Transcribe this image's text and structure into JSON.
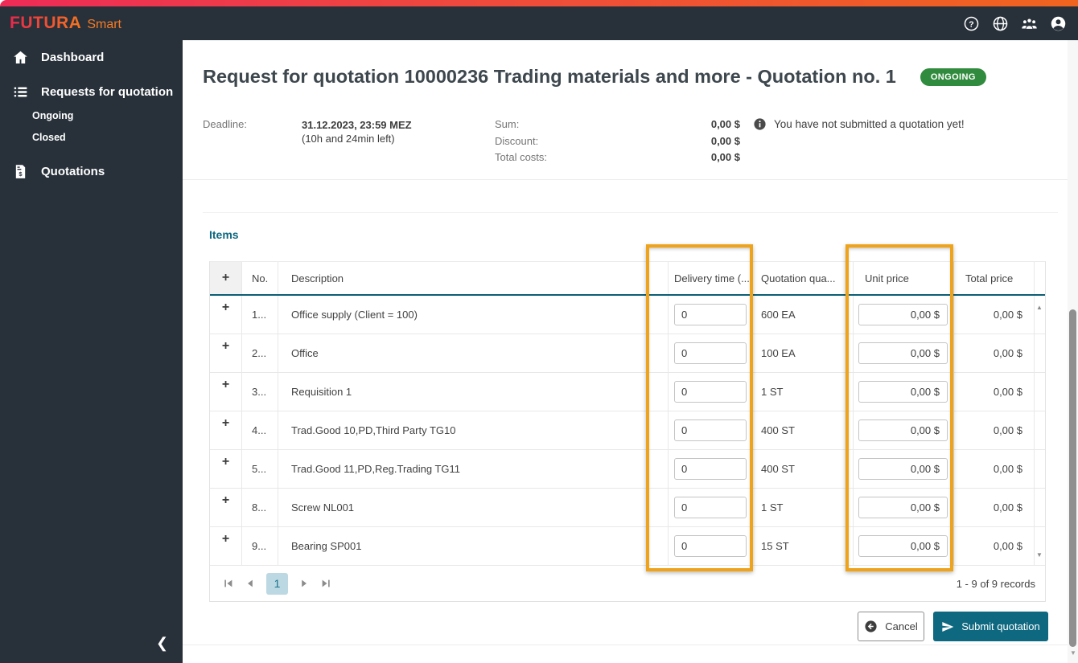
{
  "topbar": {
    "brand": "FUTURA",
    "brand_suffix": "Smart",
    "icons": [
      "help-icon",
      "language-globe-icon",
      "users-group-icon",
      "account-icon"
    ]
  },
  "sidebar": {
    "items": [
      {
        "label": "Dashboard",
        "icon": "home-icon"
      },
      {
        "label": "Requests for quotation",
        "icon": "list-icon"
      },
      {
        "label": "Quotations",
        "icon": "receipt-dollar-icon"
      }
    ],
    "subitems": [
      {
        "label": "Ongoing"
      },
      {
        "label": "Closed"
      }
    ],
    "collapse_icon": "chevron-left-icon"
  },
  "header": {
    "title": "Request for quotation 10000236 Trading materials and more - Quotation no. 1",
    "status_badge": "ONGOING",
    "deadline_label": "Deadline:",
    "deadline_value": "31.12.2023, 23:59 MEZ",
    "deadline_remaining": "(10h and 24min left)",
    "summary": [
      {
        "label": "Sum:",
        "value": "0,00 $"
      },
      {
        "label": "Discount:",
        "value": "0,00 $"
      },
      {
        "label": "Total costs:",
        "value": "0,00 $"
      }
    ],
    "info_message": "You have not submitted a quotation yet!"
  },
  "items_section": {
    "title": "Items",
    "expand_symbol": "+",
    "table": {
      "columns": [
        "+",
        "No.",
        "Description",
        "Delivery time (...",
        "Quotation qua...",
        "Unit price",
        "Total price"
      ],
      "rows": [
        {
          "no": "1...",
          "description": "Office supply (Client = 100)",
          "delivery_time": "0",
          "quantity": "600 EA",
          "unit_price": "0,00 $",
          "total_price": "0,00 $"
        },
        {
          "no": "2...",
          "description": "Office",
          "delivery_time": "0",
          "quantity": "100 EA",
          "unit_price": "0,00 $",
          "total_price": "0,00 $"
        },
        {
          "no": "3...",
          "description": "Requisition 1",
          "delivery_time": "0",
          "quantity": "1 ST",
          "unit_price": "0,00 $",
          "total_price": "0,00 $"
        },
        {
          "no": "4...",
          "description": "Trad.Good 10,PD,Third Party TG10",
          "delivery_time": "0",
          "quantity": "400 ST",
          "unit_price": "0,00 $",
          "total_price": "0,00 $"
        },
        {
          "no": "5...",
          "description": "Trad.Good 11,PD,Reg.Trading TG11",
          "delivery_time": "0",
          "quantity": "400 ST",
          "unit_price": "0,00 $",
          "total_price": "0,00 $"
        },
        {
          "no": "8...",
          "description": "Screw NL001",
          "delivery_time": "0",
          "quantity": "1 ST",
          "unit_price": "0,00 $",
          "total_price": "0,00 $"
        },
        {
          "no": "9...",
          "description": "Bearing SP001",
          "delivery_time": "0",
          "quantity": "15 ST",
          "unit_price": "0,00 $",
          "total_price": "0,00 $"
        }
      ]
    },
    "pagination": {
      "current_page": "1",
      "records": "1 - 9 of 9 records"
    }
  },
  "footer": {
    "cancel_label": "Cancel",
    "submit_label": "Submit quotation"
  },
  "colors": {
    "accent_teal": "#0e6880",
    "badge_green": "#318b3e",
    "highlight_orange": "#efa31a",
    "strip_left": "#ee2b57",
    "strip_right": "#f0641f",
    "sidebar_bg": "#28313a",
    "current_page_bg": "#bcd9e3"
  }
}
